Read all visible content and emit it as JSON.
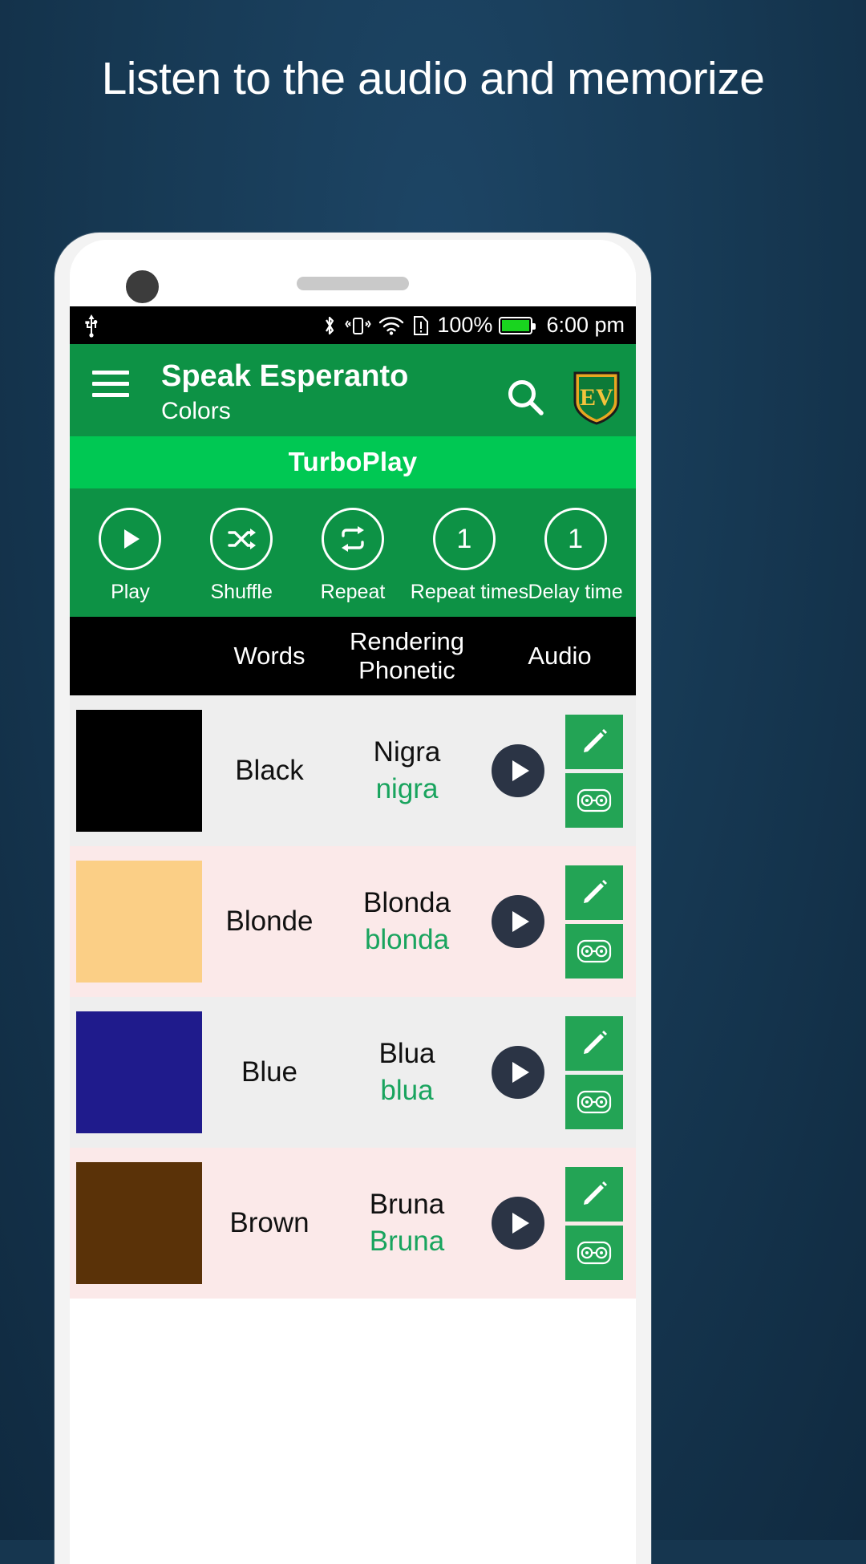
{
  "promo": {
    "tagline": "Listen to the audio and memorize",
    "bg_color": "#16364f"
  },
  "statusbar": {
    "usb_icon": "usb-icon",
    "bluetooth_icon": "bluetooth-icon",
    "vibrate_icon": "vibrate-icon",
    "wifi_icon": "wifi-icon",
    "sim_icon": "sim-alert-icon",
    "battery_percent": "100%",
    "battery_icon": "battery-full-icon",
    "time": "6:00 pm"
  },
  "appbar": {
    "menu_icon": "hamburger-menu-icon",
    "title": "Speak Esperanto",
    "subtitle": "Colors",
    "search_icon": "search-icon",
    "logo": "ev-shield-logo",
    "logo_text": "EV",
    "brand_color": "#0d9245"
  },
  "turboplay": {
    "label": "TurboPlay",
    "color": "#00c853"
  },
  "controls": [
    {
      "label": "Play",
      "icon": "play-icon",
      "value": ""
    },
    {
      "label": "Shuffle",
      "icon": "shuffle-icon",
      "value": ""
    },
    {
      "label": "Repeat",
      "icon": "repeat-icon",
      "value": ""
    },
    {
      "label": "Repeat times",
      "icon": "number-badge",
      "value": "1"
    },
    {
      "label": "Delay time",
      "icon": "number-badge",
      "value": "1"
    }
  ],
  "table": {
    "headers": {
      "swatch": "",
      "words": "Words",
      "phonetic_line1": "Rendering",
      "phonetic_line2": "Phonetic",
      "audio": "Audio"
    },
    "rows": [
      {
        "word": "Black",
        "translation": "Nigra",
        "phonetic": "nigra",
        "swatch_color": "#000000",
        "row_bg": "#eeeeee",
        "play_icon": "play-circle-icon",
        "edit_icon": "pencil-edit-icon",
        "flash_icon": "flashcard-icon"
      },
      {
        "word": "Blonde",
        "translation": "Blonda",
        "phonetic": "blonda",
        "swatch_color": "#fbcf86",
        "row_bg": "#fbe9e9",
        "play_icon": "play-circle-icon",
        "edit_icon": "pencil-edit-icon",
        "flash_icon": "flashcard-icon"
      },
      {
        "word": "Blue",
        "translation": "Blua",
        "phonetic": "blua",
        "swatch_color": "#1f1b8c",
        "row_bg": "#eeeeee",
        "play_icon": "play-circle-icon",
        "edit_icon": "pencil-edit-icon",
        "flash_icon": "flashcard-icon"
      },
      {
        "word": "Brown",
        "translation": "Bruna",
        "phonetic": "Bruna",
        "swatch_color": "#5a3208",
        "row_bg": "#fbe9e9",
        "play_icon": "play-circle-icon",
        "edit_icon": "pencil-edit-icon",
        "flash_icon": "flashcard-icon"
      }
    ]
  }
}
